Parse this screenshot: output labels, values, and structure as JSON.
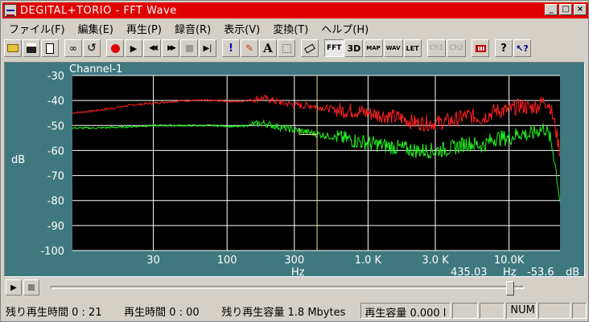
{
  "window": {
    "title": "DEGITAL+TORIO - FFT Wave",
    "buttons": {
      "minimize": "_",
      "maximize": "□",
      "close": "×"
    }
  },
  "menu": [
    {
      "label": "ファイル(F)"
    },
    {
      "label": "編集(E)"
    },
    {
      "label": "再生(P)"
    },
    {
      "label": "録音(R)"
    },
    {
      "label": "表示(V)"
    },
    {
      "label": "変換(T)"
    },
    {
      "label": "ヘルプ(H)"
    }
  ],
  "toolbar": {
    "text_buttons": {
      "fft": "FFT",
      "3d": "3D",
      "map": "MAP",
      "wav": "WAV",
      "let": "LET",
      "ch1": "Ch1",
      "ch2": "Ch2"
    },
    "glyphs": {
      "excl": "!",
      "font": "A",
      "help": "?"
    }
  },
  "scope": {
    "channel_label": "Channel-1",
    "cursor_readout": {
      "freq": "435.03",
      "freq_unit": "Hz",
      "level": "-53.6",
      "level_unit": "dB"
    }
  },
  "status": {
    "remaining_time": "残り再生時間 0 : 21",
    "play_time": "再生時間 0 : 00",
    "remaining_capacity": "残り再生容量 1.8 Mbytes",
    "capacity": "再生容量 0.000 l",
    "num": "NUM"
  },
  "playback": {
    "position": 0.98
  },
  "chart_data": {
    "type": "line",
    "xlabel": "Hz",
    "ylabel": "dB",
    "xscale": "log",
    "xlim": [
      8,
      23000
    ],
    "ylim": [
      -100,
      -30
    ],
    "grid": true,
    "x_ticks": [
      {
        "value": 30,
        "label": "30"
      },
      {
        "value": 100,
        "label": "100"
      },
      {
        "value": 300,
        "label": "300"
      },
      {
        "value": 1000,
        "label": "1.0 K"
      },
      {
        "value": 3000,
        "label": "3.0 K"
      },
      {
        "value": 10000,
        "label": "10.0K"
      }
    ],
    "y_ticks": [
      -30,
      -40,
      -50,
      -60,
      -70,
      -80,
      -90,
      -100
    ],
    "cursor": {
      "x": 435.03,
      "y": -53.6
    },
    "series": [
      {
        "color": "#ff2020",
        "x": [
          8,
          12,
          20,
          30,
          50,
          80,
          120,
          180,
          250,
          320,
          400,
          500,
          650,
          800,
          1000,
          1300,
          1700,
          2200,
          3000,
          4000,
          5000,
          6500,
          8000,
          10000,
          12000,
          14000,
          16000,
          18000,
          19500,
          21000,
          22000,
          23000
        ],
        "y": [
          -45,
          -44,
          -42,
          -41,
          -40,
          -40,
          -40.5,
          -39,
          -41,
          -42,
          -42,
          -43,
          -44,
          -44,
          -45,
          -46,
          -47,
          -49,
          -49,
          -48,
          -46,
          -47,
          -44,
          -44,
          -42,
          -43,
          -42,
          -40,
          -42,
          -49,
          -55,
          -61
        ]
      },
      {
        "color": "#20f020",
        "x": [
          8,
          12,
          20,
          30,
          50,
          80,
          120,
          180,
          250,
          320,
          400,
          500,
          650,
          800,
          1000,
          1300,
          1700,
          2200,
          3000,
          4000,
          5000,
          6500,
          8000,
          10000,
          12000,
          14000,
          16000,
          18000,
          19500,
          21000,
          22000,
          23000
        ],
        "y": [
          -51,
          -51,
          -50.5,
          -50,
          -50,
          -50,
          -50.5,
          -49,
          -51,
          -52,
          -53,
          -54,
          -55,
          -56,
          -57,
          -58,
          -59,
          -60,
          -60,
          -59,
          -57,
          -58,
          -55,
          -55,
          -53,
          -54,
          -52,
          -51,
          -55,
          -63,
          -72,
          -80
        ]
      }
    ]
  }
}
